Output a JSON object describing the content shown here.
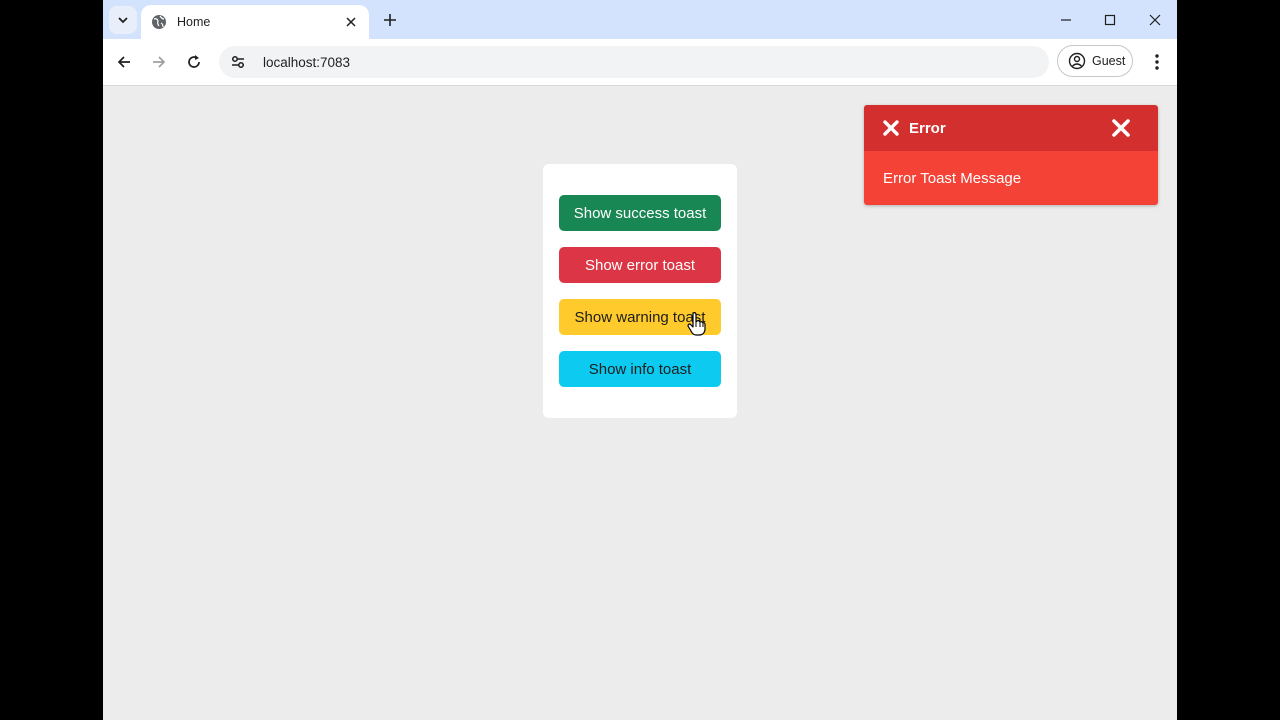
{
  "browser": {
    "tab": {
      "title": "Home"
    },
    "address": {
      "url": "localhost:7083"
    },
    "profile": {
      "label": "Guest"
    }
  },
  "page": {
    "buttons": {
      "success": "Show success toast",
      "error": "Show error toast",
      "warning": "Show warning toast",
      "info": "Show info toast"
    },
    "toast": {
      "title": "Error",
      "message": "Error Toast Message"
    }
  },
  "colors": {
    "success": "#198754",
    "error": "#dc3545",
    "warning": "#ffca2c",
    "info": "#0dcaf0",
    "toast_header": "#d32f2f",
    "toast_body": "#f44336"
  },
  "icons": [
    "tab-search-icon",
    "globe-icon",
    "close-tab-icon",
    "new-tab-icon",
    "minimize-icon",
    "maximize-icon",
    "close-window-icon",
    "back-icon",
    "forward-icon",
    "reload-icon",
    "site-settings-icon",
    "profile-icon",
    "menu-icon",
    "error-x-icon",
    "toast-close-icon"
  ]
}
